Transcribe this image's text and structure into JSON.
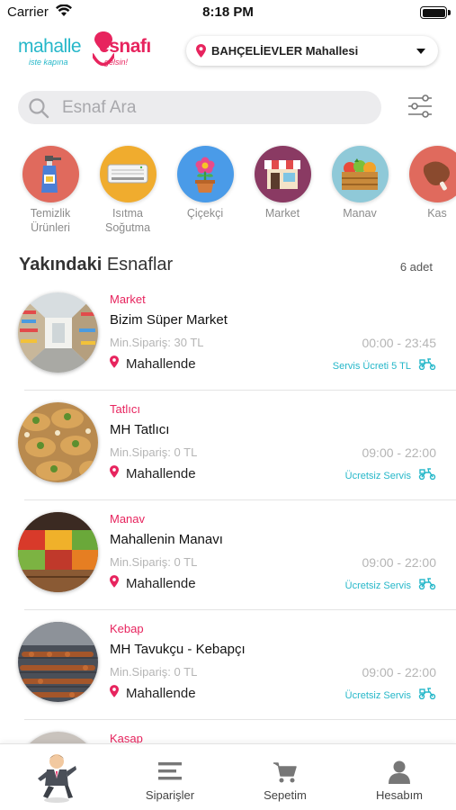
{
  "status_bar": {
    "carrier": "Carrier",
    "time": "8:18 PM"
  },
  "logo": {
    "word1": "mahalle",
    "word2": "esnafı",
    "tag1": "iste kapına",
    "tag2": "gelsin!"
  },
  "location": {
    "label": "BAHÇELİEVLER Mahallesi"
  },
  "search": {
    "placeholder": "Esnaf Ara"
  },
  "categories": [
    {
      "label_line1": "Temizlik",
      "label_line2": "Ürünleri",
      "icon": "cleaning-spray-icon",
      "color": "#e06a5d"
    },
    {
      "label_line1": "Isıtma",
      "label_line2": "Soğutma",
      "icon": "air-conditioner-icon",
      "color": "#f0ac2e"
    },
    {
      "label_line1": "Çiçekçi",
      "label_line2": "",
      "icon": "flower-pot-icon",
      "color": "#4a9be8"
    },
    {
      "label_line1": "Market",
      "label_line2": "",
      "icon": "storefront-icon",
      "color": "#8a3a63"
    },
    {
      "label_line1": "Manav",
      "label_line2": "",
      "icon": "vegetable-crate-icon",
      "color": "#8fc9d8"
    },
    {
      "label_line1": "Kas",
      "label_line2": "",
      "icon": "meat-icon",
      "color": "#e06a5d"
    }
  ],
  "section": {
    "title_bold": "Yakındaki",
    "title_rest": " Esnaflar",
    "count": "6 adet"
  },
  "shops": [
    {
      "category": "Market",
      "name": "Bizim Süper Market",
      "min_order": "Min.Sipariş: 30 TL",
      "hours": "00:00 - 23:45",
      "location": "Mahallende",
      "service": "Servis Ücreti 5 TL"
    },
    {
      "category": "Tatlıcı",
      "name": "MH Tatlıcı",
      "min_order": "Min.Sipariş: 0 TL",
      "hours": "09:00 - 22:00",
      "location": "Mahallende",
      "service": "Ücretsiz Servis"
    },
    {
      "category": "Manav",
      "name": "Mahallenin Manavı",
      "min_order": "Min.Sipariş: 0 TL",
      "hours": "09:00 - 22:00",
      "location": "Mahallende",
      "service": "Ücretsiz Servis"
    },
    {
      "category": "Kebap",
      "name": "MH Tavukçu - Kebapçı",
      "min_order": "Min.Sipariş: 0 TL",
      "hours": "09:00 - 22:00",
      "location": "Mahallende",
      "service": "Ücretsiz Servis"
    },
    {
      "category": "Kasap",
      "name": "",
      "min_order": "",
      "hours": "",
      "location": "",
      "service": ""
    }
  ],
  "tabbar": {
    "orders": "Siparişler",
    "cart": "Sepetim",
    "account": "Hesabım"
  },
  "colors": {
    "brand_pink": "#e7245e",
    "brand_teal": "#25b7c9"
  }
}
